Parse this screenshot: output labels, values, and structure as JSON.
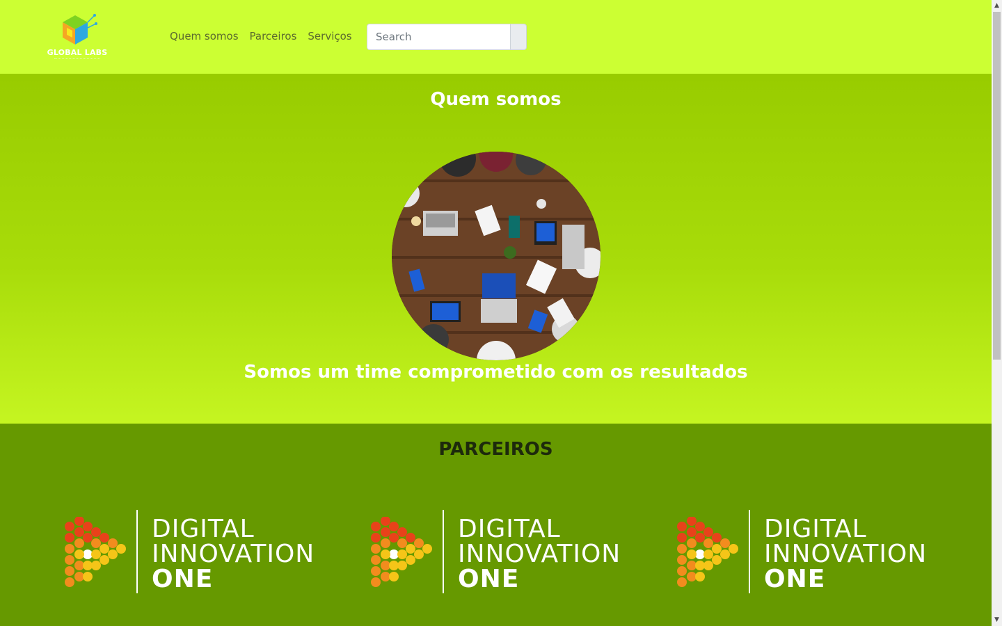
{
  "brand": {
    "name": "GLOBAL LABS",
    "logo_icon": "cube-logo-icon"
  },
  "nav": {
    "items": [
      {
        "label": "Quem somos"
      },
      {
        "label": "Parceiros"
      },
      {
        "label": "Serviços"
      }
    ]
  },
  "search": {
    "placeholder": "Search",
    "value": ""
  },
  "about": {
    "title": "Quem somos",
    "tagline": "Somos um time comprometido com os resultados"
  },
  "partners": {
    "title": "PARCEIROS",
    "items": [
      {
        "line1": "DIGITAL",
        "line2": "INNOVATION",
        "line3": "ONE"
      },
      {
        "line1": "DIGITAL",
        "line2": "INNOVATION",
        "line3": "ONE"
      },
      {
        "line1": "DIGITAL",
        "line2": "INNOVATION",
        "line3": "ONE"
      }
    ]
  },
  "colors": {
    "navbar": "#ccff33",
    "about_bg": "#99cc00",
    "partners_bg": "#669900"
  }
}
